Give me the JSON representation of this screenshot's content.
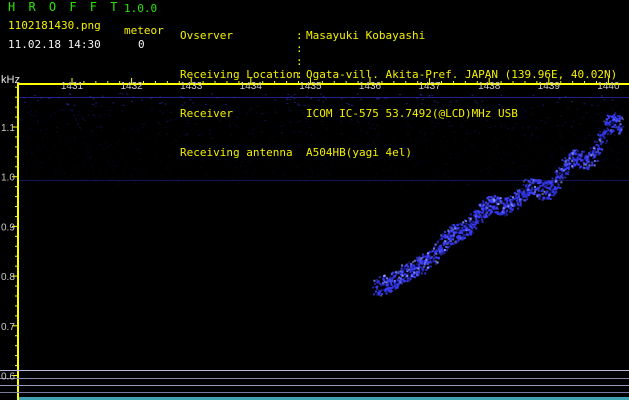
{
  "header": {
    "app_title": "H R O F F T",
    "app_version": "1.0.0",
    "file_name": "1102181430.png",
    "meteor_label": "meteor",
    "datetime": "11.02.18 14:30",
    "meteor_count": "0"
  },
  "info": {
    "labels": [
      "Ovserver",
      "Receiving Location",
      "Receiver",
      "Receiving antenna"
    ],
    "values": [
      "Masayuki Kobayashi",
      "Ogata-vill. Akita-Pref. JAPAN (139.96E, 40.02N)",
      "ICOM IC-575 53.7492(@LCD)MHz USB",
      "A504HB(yagi 4el)"
    ]
  },
  "spectrogram": {
    "y_unit": "kHz",
    "y_ticks": [
      "1.1",
      "1.0",
      "0.9",
      "0.8",
      "0.7",
      "0.6"
    ],
    "x_ticks": [
      "1431",
      "1432",
      "1433",
      "1434",
      "1435",
      "1436",
      "1437",
      "1438",
      "1439",
      "1440"
    ],
    "colors": {
      "signal": "#3a3cff",
      "axis": "#ffff00",
      "text": "#e6e6e6",
      "tick_text": "#c9c9c9"
    }
  }
}
